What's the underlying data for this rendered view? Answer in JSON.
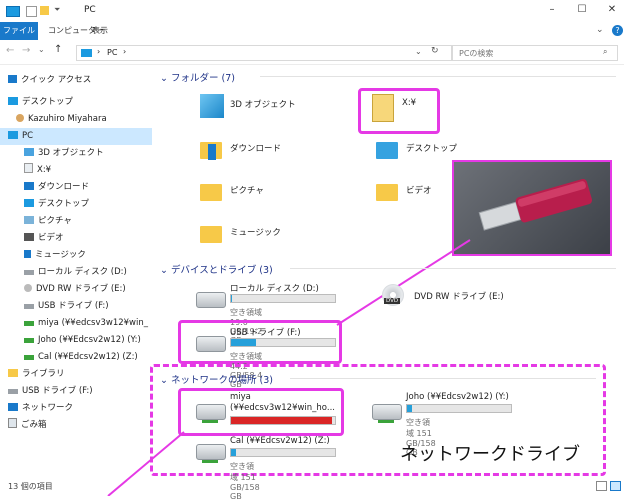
{
  "window": {
    "title": "PC",
    "minimize": "–",
    "maximize": "☐",
    "close": "✕"
  },
  "ribbon": {
    "tabs": [
      "ファイル",
      "コンピューター",
      "表示"
    ]
  },
  "address": {
    "path": "PC",
    "search_placeholder": "PCの検索"
  },
  "nav": {
    "items": [
      {
        "label": "クイック アクセス"
      },
      {
        "label": "デスクトップ"
      },
      {
        "label": "Kazuhiro Miyahara"
      },
      {
        "label": "PC"
      },
      {
        "label": "3D オブジェクト"
      },
      {
        "label": "X:¥"
      },
      {
        "label": "ダウンロード"
      },
      {
        "label": "デスクトップ"
      },
      {
        "label": "ピクチャ"
      },
      {
        "label": "ビデオ"
      },
      {
        "label": "ミュージック"
      },
      {
        "label": "ローカル ディスク (D:)"
      },
      {
        "label": "DVD RW ドライブ (E:)"
      },
      {
        "label": "USB ドライブ (F:)"
      },
      {
        "label": "miya (¥¥edcsv3w12¥win_"
      },
      {
        "label": "Joho (¥¥Edcsv2w12) (Y:)"
      },
      {
        "label": "Cal (¥¥Edcsv2w12) (Z:)"
      },
      {
        "label": "ライブラリ"
      },
      {
        "label": "USB ドライブ (F:)"
      },
      {
        "label": "ネットワーク"
      },
      {
        "label": "ごみ箱"
      }
    ]
  },
  "folders": {
    "header": "フォルダー (7)",
    "items": [
      {
        "label": "3D オブジェクト"
      },
      {
        "label": "X:¥"
      },
      {
        "label": "ダウンロード"
      },
      {
        "label": "デスクトップ"
      },
      {
        "label": "ピクチャ"
      },
      {
        "label": "ビデオ"
      },
      {
        "label": "ミュージック"
      }
    ]
  },
  "drives": {
    "header": "デバイスとドライブ (3)",
    "local": {
      "label": "ローカル ディスク (D:)",
      "free": "空き領域 19.0 GB/19.2 GB",
      "used_fraction": 0.01
    },
    "dvd": {
      "label": "DVD RW ドライブ (E:)",
      "icon_text": "DVD"
    },
    "usb": {
      "label": "USB ドライブ (F:)",
      "free": "空き領域 44.2 GB/58.4 GB",
      "used_fraction": 0.24
    }
  },
  "network": {
    "header": "ネットワークの場所 (3)",
    "miya": {
      "label": "miya",
      "path": "(¥¥edcsv3w12¥win_ho...",
      "used_fraction": 0.97
    },
    "joho": {
      "label": "Joho (¥¥Edcsv2w12) (Y:)",
      "free": "空き領域 151 GB/158 GB",
      "used_fraction": 0.05
    },
    "cal": {
      "label": "Cal (¥¥Edcsv2w12) (Z:)",
      "free": "空き領域 151 GB/158 GB",
      "used_fraction": 0.05
    },
    "annotation": "ネットワークドライブ"
  },
  "status": {
    "count": "13 個の項目"
  },
  "colors": {
    "accent": "#1979ca",
    "highlight": "#e539e5",
    "bar_blue": "#26a0da",
    "bar_red": "#da2626"
  }
}
